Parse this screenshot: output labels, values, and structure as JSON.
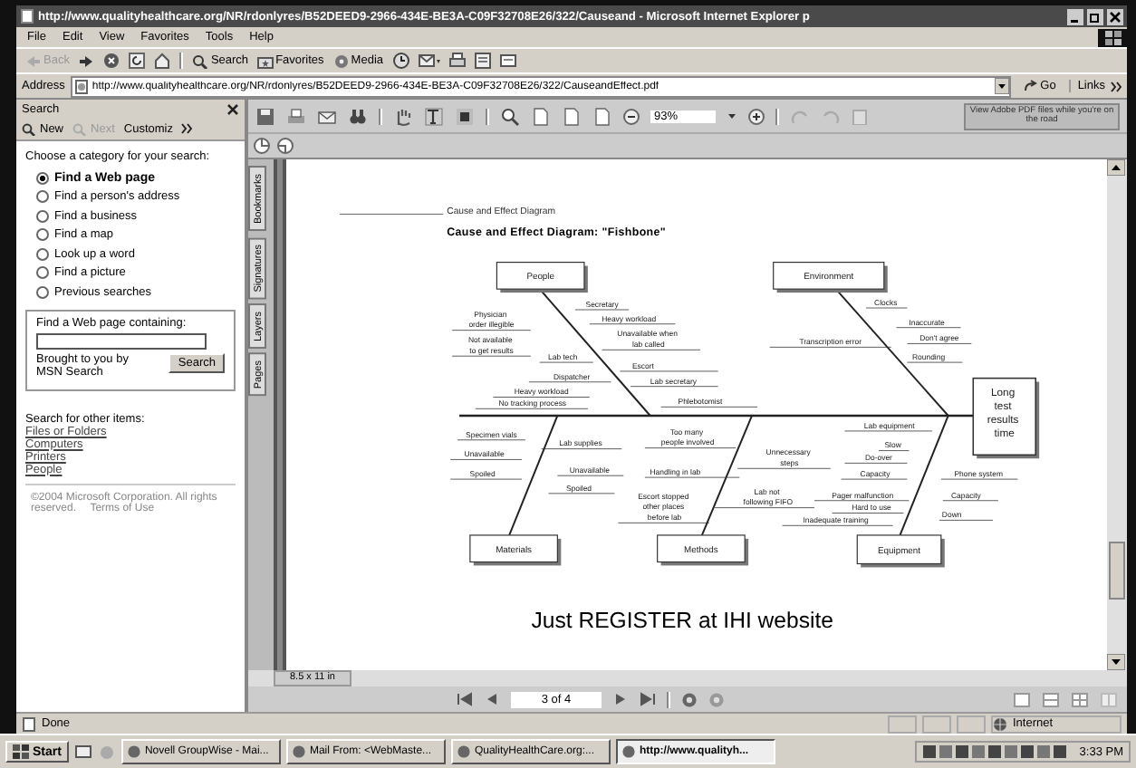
{
  "window": {
    "title": "http://www.qualityhealthcare.org/NR/rdonlyres/B52DEED9-2966-434E-BE3A-C09F32708E26/322/Causeand - Microsoft Internet Explorer p"
  },
  "menu": [
    "File",
    "Edit",
    "View",
    "Favorites",
    "Tools",
    "Help"
  ],
  "toolbar": [
    {
      "label": "Back",
      "disabled": true
    },
    {
      "label": "Search",
      "disabled": false
    },
    {
      "label": "Favorites",
      "disabled": false
    },
    {
      "label": "Media",
      "disabled": false
    }
  ],
  "address": {
    "label": "Address",
    "value": "http://www.qualityhealthcare.org/NR/rdonlyres/B52DEED9-2966-434E-BE3A-C09F32708E26/322/CauseandEffect.pdf",
    "go": "Go",
    "links": "Links"
  },
  "search_pane": {
    "title": "Search",
    "new": "New",
    "next": "Next",
    "customize": "Customiz",
    "prompt": "Choose a category for your search:",
    "categories": [
      {
        "label": "Find a Web page",
        "selected": true
      },
      {
        "label": "Find a person's address",
        "selected": false
      },
      {
        "label": "Find a business",
        "selected": false
      },
      {
        "label": "Find a map",
        "selected": false
      },
      {
        "label": "Look up a word",
        "selected": false
      },
      {
        "label": "Find a picture",
        "selected": false
      },
      {
        "label": "Previous searches",
        "selected": false
      }
    ],
    "box_label": "Find a Web page containing:",
    "brought_by": "Brought to you by MSN Search",
    "search_button": "Search",
    "other_heading": "Search for other items:",
    "other_links": [
      "Files or Folders",
      "Computers",
      "Printers",
      "People"
    ],
    "copyright": "©2004 Microsoft Corporation. All rights reserved.",
    "terms": "Terms of Use"
  },
  "pdf": {
    "side_tabs": [
      "Bookmarks",
      "Signatures",
      "Layers",
      "Pages"
    ],
    "zoom": "93%",
    "promo": "View Adobe PDF files while you're on the road",
    "page_size": "8.5 x 11 in",
    "page_indicator": "3 of 4"
  },
  "document": {
    "header": "Cause and Effect Diagram",
    "title": "Cause and Effect Diagram: \"Fishbone\"",
    "effect": [
      "Long",
      "test",
      "results",
      "time"
    ],
    "categories": [
      {
        "name": "People",
        "causes": [
          {
            "lines": [
              "Physician",
              "order illegible"
            ]
          },
          {
            "lines": [
              "Not available",
              "to get results"
            ]
          },
          {
            "lines": [
              "Secretary"
            ]
          },
          {
            "lines": [
              "Heavy workload"
            ]
          },
          {
            "lines": [
              "Unavailable when",
              "lab called"
            ]
          },
          {
            "lines": [
              "Lab tech"
            ]
          },
          {
            "lines": [
              "Escort"
            ]
          },
          {
            "lines": [
              "Dispatcher"
            ]
          },
          {
            "lines": [
              "Lab secretary"
            ]
          },
          {
            "lines": [
              "Heavy workload"
            ]
          },
          {
            "lines": [
              "No tracking process"
            ]
          },
          {
            "lines": [
              "Phlebotomist"
            ]
          }
        ]
      },
      {
        "name": "Environment",
        "causes": [
          {
            "lines": [
              "Clocks"
            ]
          },
          {
            "lines": [
              "Inaccurate"
            ]
          },
          {
            "lines": [
              "Don't agree"
            ]
          },
          {
            "lines": [
              "Transcription error"
            ]
          },
          {
            "lines": [
              "Rounding"
            ]
          }
        ]
      },
      {
        "name": "Materials",
        "causes": [
          {
            "lines": [
              "Specimen vials"
            ]
          },
          {
            "lines": [
              "Unavailable"
            ]
          },
          {
            "lines": [
              "Spoiled"
            ]
          },
          {
            "lines": [
              "Lab supplies"
            ]
          },
          {
            "lines": [
              "Unavailable"
            ]
          },
          {
            "lines": [
              "Spoiled"
            ]
          }
        ]
      },
      {
        "name": "Methods",
        "causes": [
          {
            "lines": [
              "Too many",
              "people involved"
            ]
          },
          {
            "lines": [
              "Handling in lab"
            ]
          },
          {
            "lines": [
              "Escort stopped",
              "other places",
              "before lab"
            ]
          },
          {
            "lines": [
              "Unnecessary",
              "steps"
            ]
          },
          {
            "lines": [
              "Lab not",
              "following FIFO"
            ]
          }
        ]
      },
      {
        "name": "Equipment",
        "causes": [
          {
            "lines": [
              "Lab equipment"
            ]
          },
          {
            "lines": [
              "Slow"
            ]
          },
          {
            "lines": [
              "Do-over"
            ]
          },
          {
            "lines": [
              "Capacity"
            ]
          },
          {
            "lines": [
              "Pager malfunction"
            ]
          },
          {
            "lines": [
              "Hard to use"
            ]
          },
          {
            "lines": [
              "Inadequate training"
            ]
          },
          {
            "lines": [
              "Phone system"
            ]
          },
          {
            "lines": [
              "Capacity"
            ]
          },
          {
            "lines": [
              "Down"
            ]
          }
        ]
      }
    ],
    "note": "Just REGISTER at IHI website"
  },
  "status_bar": {
    "text": "Done",
    "zone": "Internet"
  },
  "taskbar": {
    "start": "Start",
    "tasks": [
      {
        "label": "Novell GroupWise - Mai...",
        "selected": false
      },
      {
        "label": "Mail From: <WebMaste...",
        "selected": false
      },
      {
        "label": "QualityHealthCare.org:...",
        "selected": false
      },
      {
        "label": "http://www.qualityh...",
        "selected": true
      }
    ],
    "clock": "3:33 PM"
  }
}
